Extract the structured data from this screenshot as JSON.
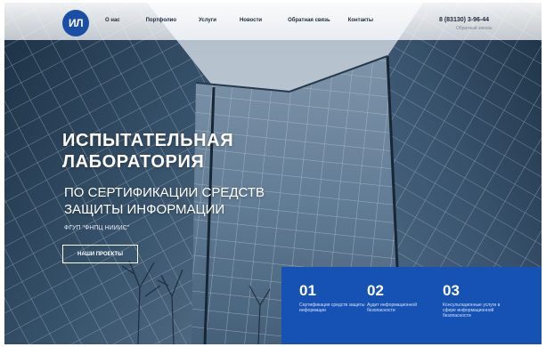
{
  "header": {
    "logo_text": "ИЛ",
    "nav": [
      "О нас",
      "Портфолио",
      "Услуги",
      "Новости",
      "Обратная связь",
      "Контакты"
    ],
    "phone": "8 (83130) 3-96-44",
    "callback_label": "Обратный звонок"
  },
  "hero": {
    "title_line1": "ИСПЫТАТЕЛЬНАЯ",
    "title_line2": "ЛАБОРАТОРИЯ",
    "subtitle_line1": "ПО СЕРТИФИКАЦИИ СРЕДСТВ",
    "subtitle_line2": "ЗАЩИТЫ ИНФОРМАЦИИ",
    "org": "ФГУП \"ФНПЦ НИИИС\"",
    "button_label": "НАШИ ПРОЕКТЫ"
  },
  "services": [
    {
      "number": "01",
      "text": "Сертификация средств защиты информации"
    },
    {
      "number": "02",
      "text": "Аудит информационной безопасности"
    },
    {
      "number": "03",
      "text": "Консультационные услуги в сфере информационной безопасности"
    }
  ],
  "colors": {
    "accent": "#1552b3",
    "logo": "#1b4fa6"
  }
}
